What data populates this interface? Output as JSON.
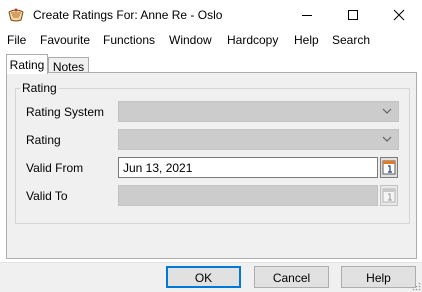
{
  "window": {
    "title": "Create Ratings For: Anne Re - Oslo",
    "icons": {
      "app": "ratings-app-icon",
      "minimize": "minimize-icon",
      "maximize": "maximize-icon",
      "close": "close-icon"
    }
  },
  "menu": {
    "items": [
      {
        "label": "File"
      },
      {
        "label": "Favourite"
      },
      {
        "label": "Functions"
      },
      {
        "label": "Window"
      },
      {
        "label": "Hardcopy"
      },
      {
        "label": "Help"
      },
      {
        "label": "Search"
      }
    ]
  },
  "tabs": [
    {
      "label": "Rating",
      "active": true
    },
    {
      "label": "Notes",
      "active": false
    }
  ],
  "form": {
    "group_label": "Rating",
    "rating_system": {
      "label": "Rating  System",
      "value": ""
    },
    "rating": {
      "label": "Rating",
      "value": ""
    },
    "valid_from": {
      "label": "Valid From",
      "value": "Jun 13, 2021"
    },
    "valid_to": {
      "label": "Valid To",
      "value": ""
    }
  },
  "buttons": {
    "ok": "OK",
    "cancel": "Cancel",
    "help": "Help"
  },
  "colors": {
    "accent": "#0078d7",
    "panel_bg": "#f0f0f0",
    "disabled_field": "#cccccc",
    "calendar_orange": "#e87a1e"
  }
}
